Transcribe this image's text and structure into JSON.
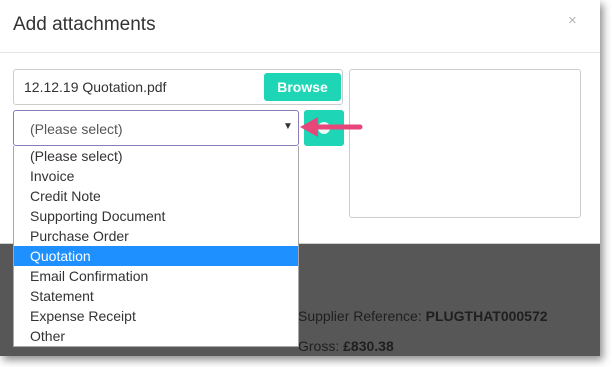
{
  "modal": {
    "title": "Add attachments",
    "close_glyph": "×"
  },
  "file": {
    "name": "12.12.19 Quotation.pdf",
    "browse_label": "Browse"
  },
  "select": {
    "value": "(Please select)",
    "caret": "▼",
    "options": [
      "(Please select)",
      "Invoice",
      "Credit Note",
      "Supporting Document",
      "Purchase Order",
      "Quotation",
      "Email Confirmation",
      "Statement",
      "Expense Receipt",
      "Other"
    ],
    "highlighted": "Quotation"
  },
  "background": {
    "supplier_ref_label": "Supplier Reference:",
    "supplier_ref_value": "PLUGTHAT000572",
    "gross_label": "Gross:",
    "gross_value": "£830.38"
  },
  "colors": {
    "accent": "#1ed6b6",
    "highlight": "#1e90ff",
    "arrow": "#e8457a"
  },
  "icons": {
    "add": "plus-icon",
    "close": "close-icon",
    "caret": "chevron-down-icon"
  }
}
